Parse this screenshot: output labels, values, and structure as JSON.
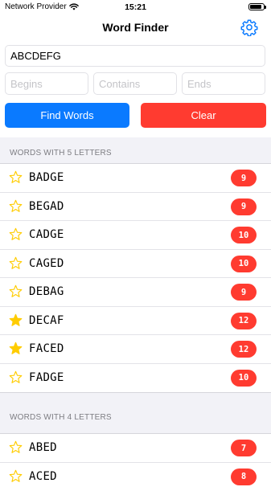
{
  "status": {
    "carrier": "Network Provider",
    "time": "15:21",
    "battery_level": 0.9
  },
  "nav": {
    "title": "Word Finder",
    "settings_icon": "gear-icon"
  },
  "form": {
    "letters_value": "ABCDEFG",
    "begins_placeholder": "Begins",
    "contains_placeholder": "Contains",
    "ends_placeholder": "Ends",
    "find_label": "Find Words",
    "clear_label": "Clear"
  },
  "colors": {
    "accent": "#0a7aff",
    "destructive": "#ff3b30",
    "star": "#ffcc00"
  },
  "sections": [
    {
      "header": "WORDS WITH 5 LETTERS",
      "words": [
        {
          "word": "BADGE",
          "score": "9",
          "favorite": false
        },
        {
          "word": "BEGAD",
          "score": "9",
          "favorite": false
        },
        {
          "word": "CADGE",
          "score": "10",
          "favorite": false
        },
        {
          "word": "CAGED",
          "score": "10",
          "favorite": false
        },
        {
          "word": "DEBAG",
          "score": "9",
          "favorite": false
        },
        {
          "word": "DECAF",
          "score": "12",
          "favorite": true
        },
        {
          "word": "FACED",
          "score": "12",
          "favorite": true
        },
        {
          "word": "FADGE",
          "score": "10",
          "favorite": false
        }
      ]
    },
    {
      "header": "WORDS WITH 4 LETTERS",
      "words": [
        {
          "word": "ABED",
          "score": "7",
          "favorite": false
        },
        {
          "word": "ACED",
          "score": "8",
          "favorite": false
        }
      ]
    }
  ]
}
